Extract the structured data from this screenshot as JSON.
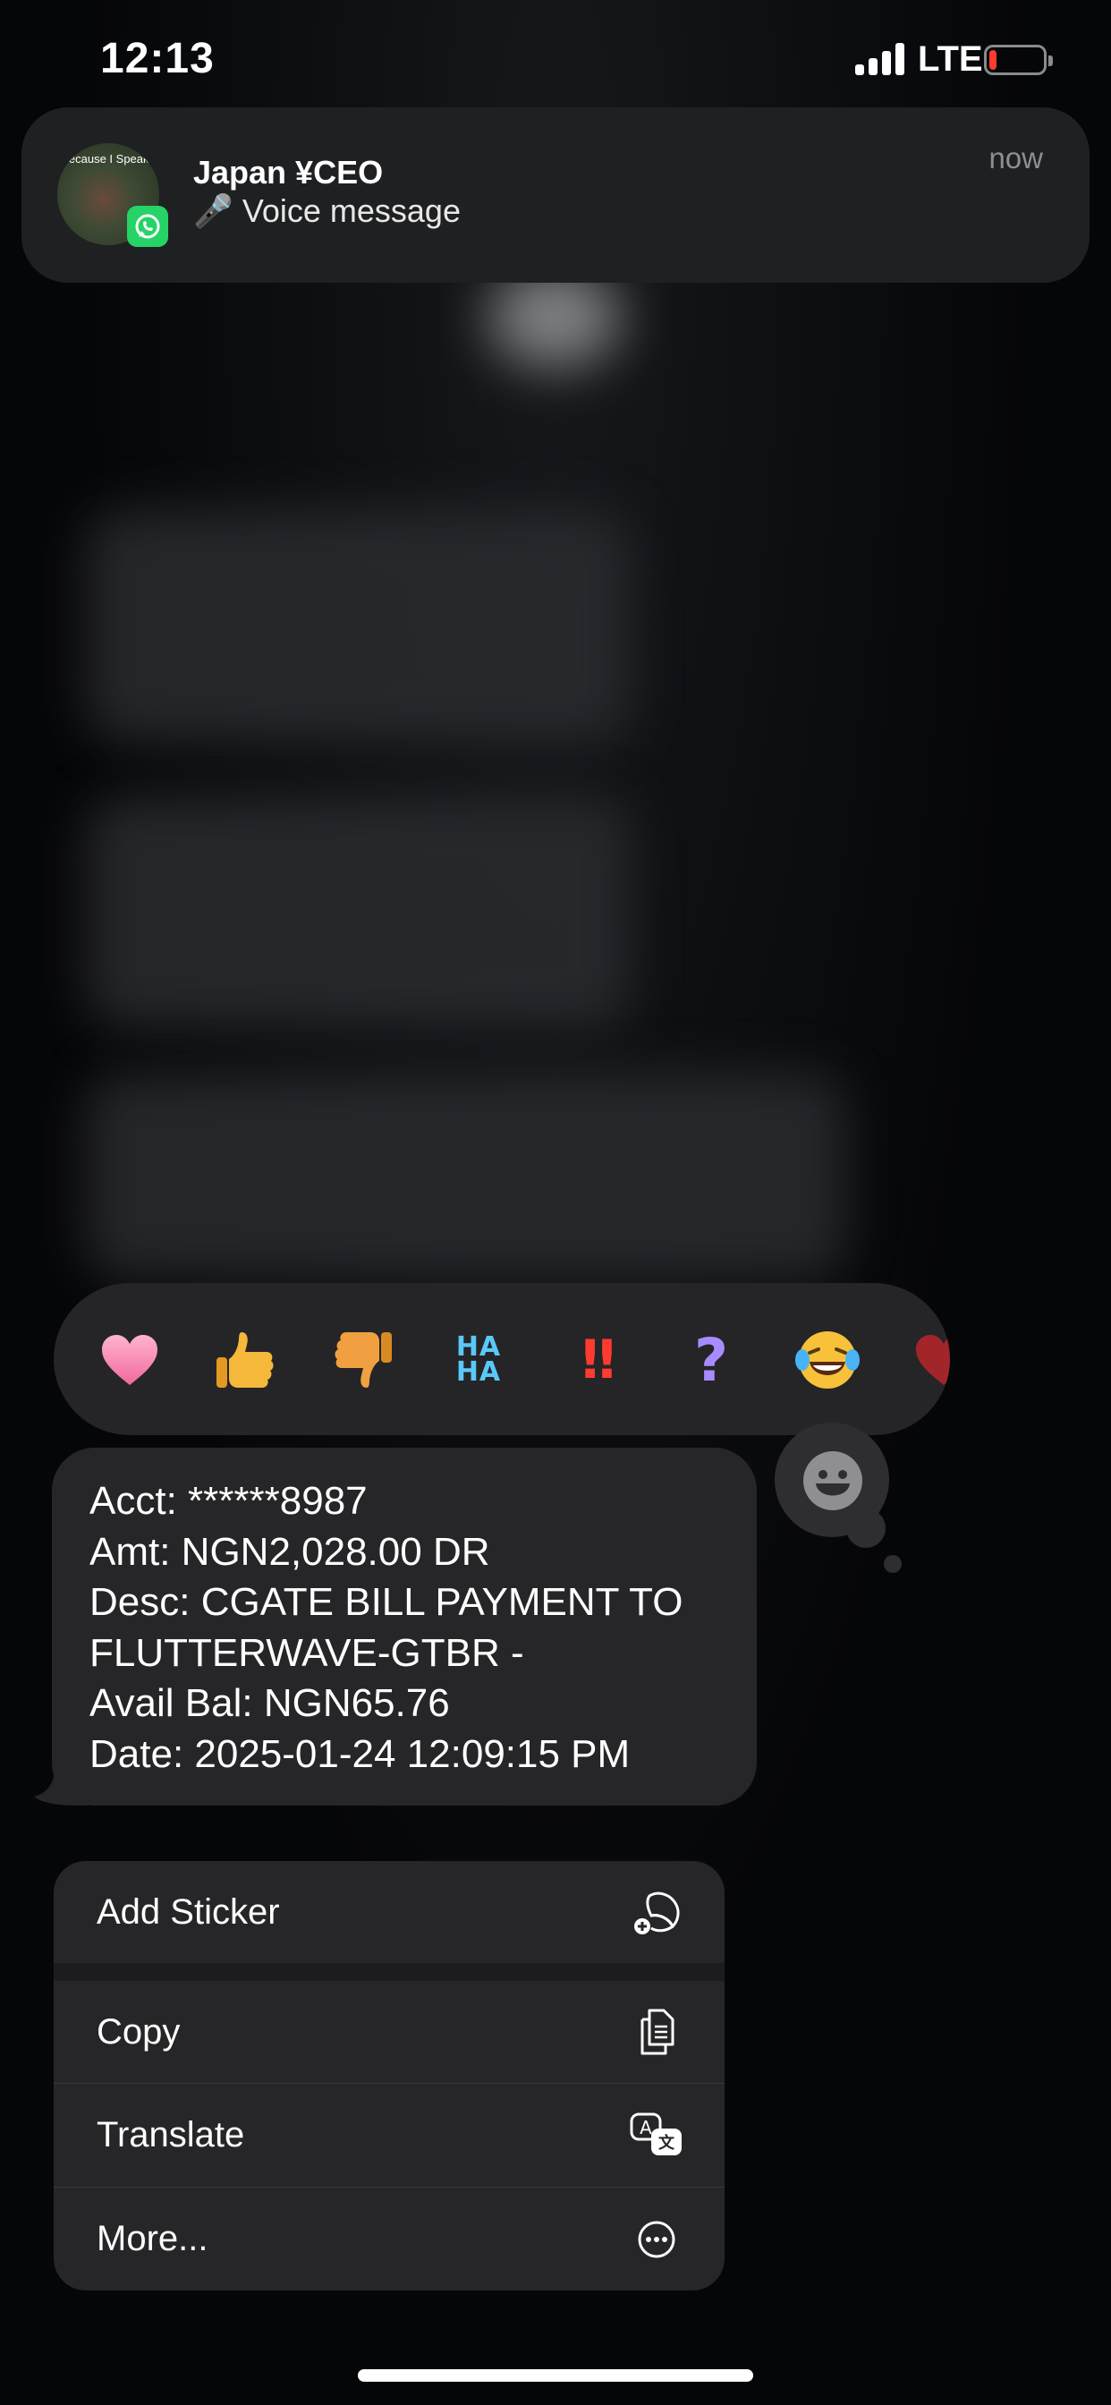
{
  "status_bar": {
    "time": "12:13",
    "network": "LTE",
    "icons": [
      "signal-bars-icon",
      "battery-low-icon"
    ],
    "battery_color": "#ff3b30"
  },
  "notification": {
    "avatar_text": "Because I Speak !",
    "app_icon": "whatsapp-icon",
    "title": "Japan ¥CEO",
    "body": "🎤 Voice message",
    "time": "now"
  },
  "reactions": {
    "items": [
      "heart",
      "thumbs-up",
      "thumbs-down",
      "haha",
      "double-exclamation",
      "question-mark",
      "laughing-crying",
      "red-heart"
    ],
    "haha_text": "HA HA",
    "excl_text": "‼",
    "question_text": "?",
    "more_icon": "smiley-add-icon"
  },
  "message": {
    "lines": [
      "Acct: ******8987",
      "Amt: NGN2,028.00 DR",
      "Desc: CGATE BILL PAYMENT TO",
      "FLUTTERWAVE-GTBR -",
      "Avail Bal: NGN65.76",
      "Date: 2025-01-24 12:09:15 PM"
    ]
  },
  "context_menu": {
    "items": [
      {
        "label": "Add Sticker",
        "icon": "sticker-add-icon"
      },
      {
        "label": "Copy",
        "icon": "copy-icon"
      },
      {
        "label": "Translate",
        "icon": "translate-icon"
      },
      {
        "label": "More...",
        "icon": "ellipsis-circle-icon"
      }
    ]
  },
  "colors": {
    "background": "#050608",
    "bubble": "#262628",
    "menu": "#262628",
    "accent_green": "#25d366"
  }
}
